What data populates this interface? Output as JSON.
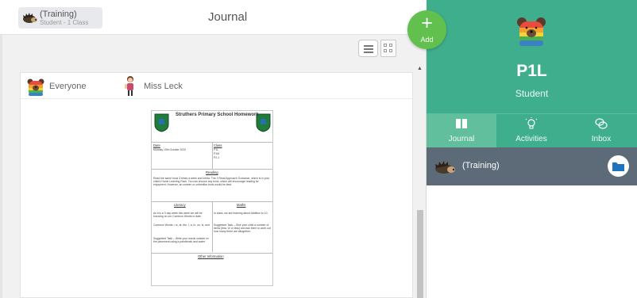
{
  "header": {
    "class_name": "(Training)",
    "class_sub": "Student - 1 Class",
    "title": "Journal"
  },
  "add_button": {
    "label": "Add",
    "icon": "plus-icon"
  },
  "feed": {
    "audience_label": "Everyone",
    "teacher_label": "Miss Leck"
  },
  "document": {
    "title": "Struthers Primary School Homework",
    "date_heading": "Date",
    "date_value": "Monday 19th October 2020",
    "class_heading": "Class",
    "class_values": [
      "P1L",
      "P1M",
      "P2-1"
    ],
    "reading_heading": "Reading",
    "reading_text": "Read the same book 3 times a week and follow: The 3 Read Approach Guidance, which is in your child's Home Learning Pack. You can choose any book, which will encourage reading for enjoyment. However, an unseen or unfamiliar book would be best.",
    "literacy_heading": "Literacy",
    "maths_heading": "Maths",
    "literacy_text_1": "As it is a 3 day week this week we will be focusing on our Common Words to date.",
    "literacy_text_2": "Common Words = is, at, the, I, a, in, on, is, and",
    "literacy_text_3": "Suggested Task – Write your words outside on the pavement using a paintbrush and water.",
    "maths_text_1": "In class, we are learning about Addition to 10.",
    "maths_text_2": "Suggested Task – Give your child a number of items (less 10 or less) and ask them to work out how many there are altogether.",
    "other_heading": "Other Information"
  },
  "profile": {
    "name": "P1L",
    "role": "Student",
    "tabs": [
      {
        "label": "Journal",
        "icon": "book-icon",
        "active": true
      },
      {
        "label": "Activities",
        "icon": "lightbulb-icon",
        "active": false
      },
      {
        "label": "Inbox",
        "icon": "chat-bubbles-icon",
        "active": false
      }
    ],
    "class_row_label": "(Training)"
  },
  "colors": {
    "brand_green": "#3fae8d",
    "active_tab": "#62bf9e",
    "add_green": "#62c04e",
    "class_row": "#5d6b78",
    "folder_blue": "#1e73be"
  }
}
